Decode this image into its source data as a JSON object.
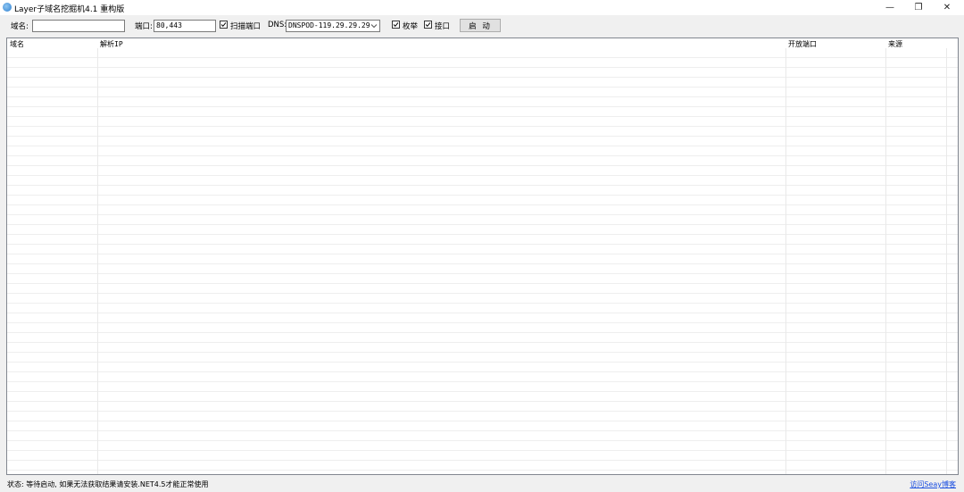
{
  "window": {
    "title": "Layer子域名挖掘机4.1 重构版",
    "controls": {
      "minimize": "—",
      "restore": "❐",
      "close": "✕"
    }
  },
  "toolbar": {
    "domain_label": "域名:",
    "domain_value": "",
    "port_label": "端口:",
    "port_value": "80,443",
    "scan_port_label": "扫描端口",
    "scan_port_checked": true,
    "dns_label": "DNS:",
    "dns_value": "DNSPOD-119.29.29.29",
    "enum_label": "枚举",
    "enum_checked": true,
    "api_label": "接口",
    "api_checked": true,
    "start_label": "启 动"
  },
  "grid": {
    "columns": [
      "域名",
      "解析IP",
      "开放端口",
      "来源"
    ],
    "rows": []
  },
  "status": {
    "text": "状态: 等待启动, 如果无法获取结果请安装.NET4.5才能正常使用",
    "link": "访问Seay博客"
  },
  "colors": {
    "link": "#1a4ee0",
    "grid_border": "#828790",
    "button_bg": "#e1e1e1"
  }
}
